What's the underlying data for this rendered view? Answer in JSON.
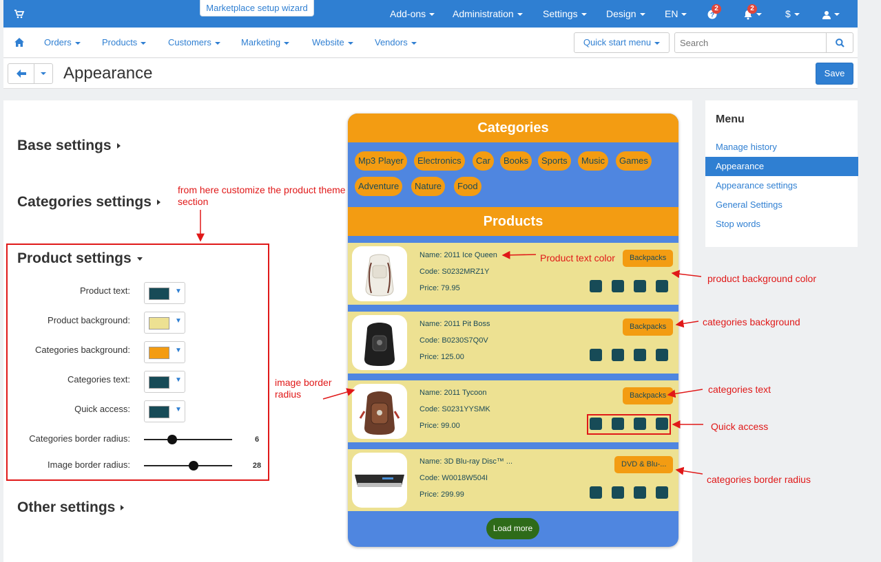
{
  "topbar": {
    "wizard_label": "Marketplace setup wizard",
    "menus": [
      "Add-ons",
      "Administration",
      "Settings",
      "Design",
      "EN"
    ],
    "help_badge": "2",
    "notif_badge": "2",
    "currency": "$",
    "colors": {
      "bar": "#2f7fd2",
      "badge": "#e0463b"
    }
  },
  "nav": {
    "items": [
      "Orders",
      "Products",
      "Customers",
      "Marketing",
      "Website",
      "Vendors"
    ],
    "quick_start": "Quick start menu",
    "search_placeholder": "Search"
  },
  "titlebar": {
    "title": "Appearance",
    "save_label": "Save"
  },
  "sections": {
    "base": "Base settings",
    "categories": "Categories settings",
    "product": "Product settings",
    "other": "Other settings"
  },
  "product_form": {
    "fields": [
      {
        "label": "Product text:",
        "color": "#174b57"
      },
      {
        "label": "Product background:",
        "color": "#ede192"
      },
      {
        "label": "Categories background:",
        "color": "#f39c12"
      },
      {
        "label": "Categories text:",
        "color": "#174b57"
      },
      {
        "label": "Quick access:",
        "color": "#174b57"
      }
    ],
    "sliders": [
      {
        "label": "Categories border radius:",
        "value": "6",
        "fraction": 0.32
      },
      {
        "label": "Image border radius:",
        "value": "28",
        "fraction": 0.56
      }
    ]
  },
  "annotations": {
    "customize_line1": "from here customize the product theme",
    "customize_line2": "section",
    "image_radius_line1": "image border",
    "image_radius_line2": "radius",
    "product_text_color": "Product text color",
    "product_bg_color": "product background color",
    "categories_bg": "categories background",
    "categories_text": "categories text",
    "quick_access": "Quick access",
    "categories_radius": "categories border radius"
  },
  "preview": {
    "categories_title": "Categories",
    "products_title": "Products",
    "categories": [
      "Mp3 Player",
      "Electronics",
      "Car",
      "Books",
      "Sports",
      "Music",
      "Games",
      "Adventure",
      "Nature",
      "Food"
    ],
    "products": [
      {
        "name": "Name: 2011 Ice Queen",
        "code": "Code: S0232MRZ1Y",
        "price": "Price: 79.95",
        "category": "Backpacks",
        "image": "white-backpack"
      },
      {
        "name": "Name: 2011 Pit Boss",
        "code": "Code: B0230S7Q0V",
        "price": "Price: 125.00",
        "category": "Backpacks",
        "image": "black-backpack"
      },
      {
        "name": "Name: 2011 Tycoon",
        "code": "Code: S0231YYSMK",
        "price": "Price: 99.00",
        "category": "Backpacks",
        "image": "brown-backpack"
      },
      {
        "name": "Name: 3D Blu-ray Disc™ ...",
        "code": "Code: W0018W504I",
        "price": "Price: 299.99",
        "category": "DVD & Blu-...",
        "image": "bluray-player"
      }
    ],
    "load_more": "Load more",
    "colors": {
      "header": "#f39c12",
      "background": "#4f86e0",
      "card": "#ede192",
      "text": "#1b4a57",
      "quick": "#174b57",
      "button": "#2e6b19"
    }
  },
  "side_menu": {
    "title": "Menu",
    "items": [
      "Manage history",
      "Appearance",
      "Appearance settings",
      "General Settings",
      "Stop words"
    ],
    "active_index": 1
  }
}
